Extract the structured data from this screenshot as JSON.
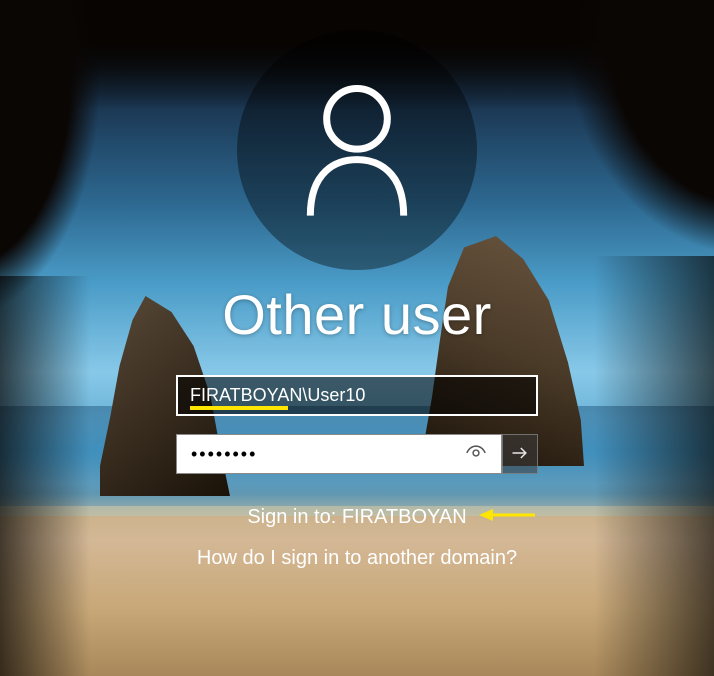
{
  "title": "Other user",
  "username": {
    "value": "FIRATBOYAN\\User10"
  },
  "password": {
    "value": "••••••••"
  },
  "sign_in_to": {
    "label": "Sign in to: ",
    "domain": "FIRATBOYAN"
  },
  "domain_help": "How do I sign in to another domain?",
  "icons": {
    "avatar": "user-icon",
    "reveal": "eye-icon",
    "submit": "arrow-right-icon"
  },
  "colors": {
    "highlight": "#ffe600"
  }
}
